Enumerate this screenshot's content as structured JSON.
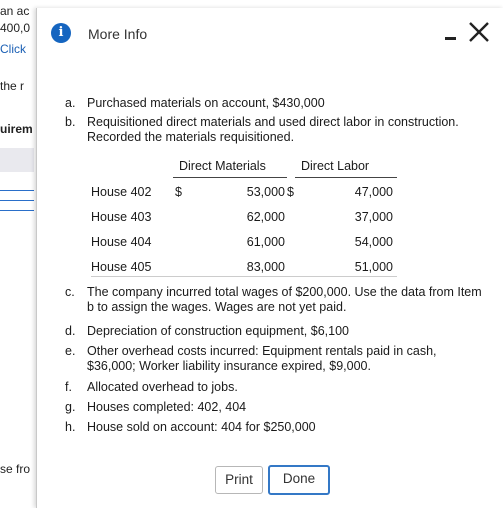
{
  "background": {
    "fragments": [
      "an ac",
      "400,0",
      "Click",
      "the r",
      "uirem",
      "se fro"
    ]
  },
  "modal": {
    "title": "More Info",
    "items": [
      {
        "letter": "a.",
        "text": "Purchased materials on account, $430,000"
      },
      {
        "letter": "b.",
        "text": "Requisitioned direct materials and used direct labor in construction. Recorded the materials requisitioned."
      },
      {
        "letter": "c.",
        "text": "The company incurred total wages of $200,000. Use the data from Item b to assign the wages. Wages are not yet paid."
      },
      {
        "letter": "d.",
        "text": "Depreciation of construction equipment, $6,100"
      },
      {
        "letter": "e.",
        "text": "Other overhead costs incurred: Equipment rentals paid in cash, $36,000; Worker liability insurance expired, $9,000."
      },
      {
        "letter": "f.",
        "text": "Allocated overhead to jobs."
      },
      {
        "letter": "g.",
        "text": "Houses completed: 402, 404"
      },
      {
        "letter": "h.",
        "text": "House sold on account: 404 for $250,000"
      }
    ],
    "table": {
      "headers": [
        "Direct Materials",
        "Direct Labor"
      ],
      "rows": [
        {
          "label": "House 402",
          "dm_sym": "$",
          "dm": "53,000",
          "dl_sym": "$",
          "dl": "47,000"
        },
        {
          "label": "House 403",
          "dm_sym": "",
          "dm": "62,000",
          "dl_sym": "",
          "dl": "37,000"
        },
        {
          "label": "House 404",
          "dm_sym": "",
          "dm": "61,000",
          "dl_sym": "",
          "dl": "54,000"
        },
        {
          "label": "House 405",
          "dm_sym": "",
          "dm": "83,000",
          "dl_sym": "",
          "dl": "51,000"
        }
      ]
    },
    "buttons": {
      "print": "Print",
      "done": "Done"
    }
  }
}
